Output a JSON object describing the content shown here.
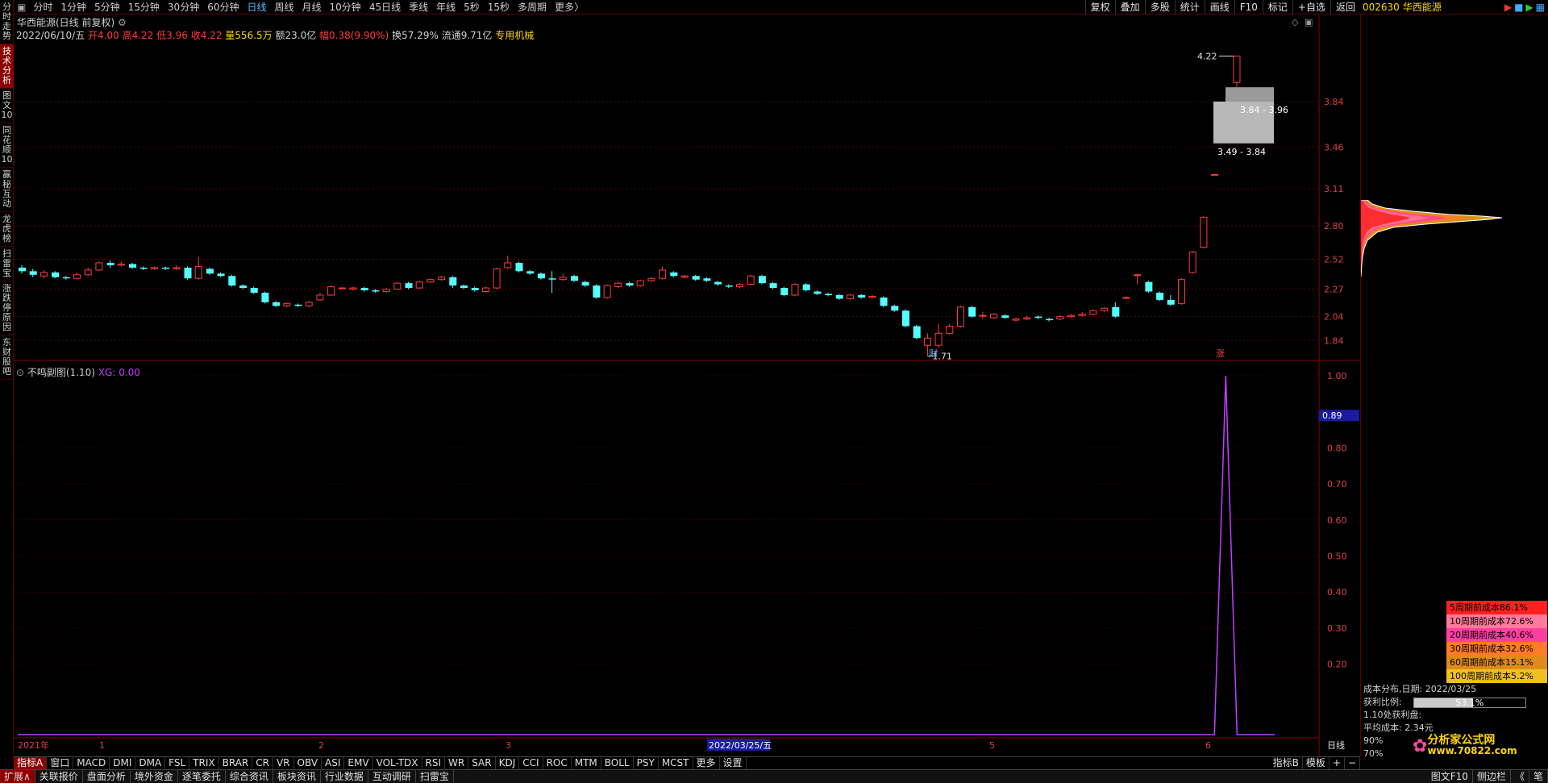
{
  "left_tabs": [
    "分时走势",
    "技术分析",
    "图文10",
    "同花顺10",
    "赢秘互动",
    "龙虎榜",
    "扫雷宝",
    "涨跌停原因",
    "东财股吧"
  ],
  "left_active": 1,
  "periods": [
    "分时",
    "1分钟",
    "5分钟",
    "15分钟",
    "30分钟",
    "60分钟",
    "日线",
    "周线",
    "月线",
    "10分钟",
    "45日线",
    "季线",
    "年线",
    "5秒",
    "15秒",
    "多周期",
    "更多〉"
  ],
  "period_active": 6,
  "tools": [
    "复权",
    "叠加",
    "多股",
    "统计",
    "画线",
    "F10",
    "标记",
    "+自选",
    "返回"
  ],
  "stock": {
    "code": "002630",
    "name": "华西能源"
  },
  "chart_title": "华西能源(日线 前复权)",
  "quote": {
    "date": "2022/06/10/五",
    "open": "开4.00",
    "high": "高4.22",
    "low": "低3.96",
    "close": "收4.22",
    "volume": "量556.5万",
    "amount": "额23.0亿",
    "change": "幅0.38(9.90%)",
    "turnover": "换57.29%",
    "float": "流通9.71亿",
    "sector": "专用机械"
  },
  "annotations": {
    "high_price": "4.22",
    "low_price": "1.71",
    "range1": "3.84 - 3.96",
    "range2": "3.49 - 3.84",
    "fin_mark": "财",
    "up_mark": "涨"
  },
  "main_axis": [
    "3.84",
    "3.46",
    "3.11",
    "2.80",
    "2.52",
    "2.27",
    "2.04",
    "1.84"
  ],
  "sub_indicator": {
    "name": "不鸣副图(1.10)",
    "xg_label": "XG: 0.00"
  },
  "sub_axis": [
    "1.00",
    "0.80",
    "0.70",
    "0.60",
    "0.50",
    "0.40",
    "0.30",
    "0.20"
  ],
  "sub_current": "0.89",
  "date_axis": [
    "2021年",
    "1",
    "2",
    "3",
    "2022/03/25/五",
    "5",
    "6"
  ],
  "period_label": "日线",
  "legend": [
    {
      "label": "5周期前成本86.1%",
      "color": "#ff2020"
    },
    {
      "label": "10周期前成本72.6%",
      "color": "#ff7a9a"
    },
    {
      "label": "20周期前成本40.6%",
      "color": "#ff3fa0"
    },
    {
      "label": "30周期前成本32.6%",
      "color": "#ff7a2a"
    },
    {
      "label": "60周期前成本15.1%",
      "color": "#e08a1a"
    },
    {
      "label": "100周期前成本5.2%",
      "color": "#f0c020"
    }
  ],
  "cost": {
    "title": "成本分布,日期:  2022/03/25",
    "profit_label": "获利比例:",
    "profit_value": "53.1%",
    "profit_at": "1.10处获利盘:",
    "avg_label": "平均成本:  2.34元",
    "p90": "90%",
    "p70": "70%"
  },
  "indicator_tabs": [
    "指标A",
    "窗口",
    "MACD",
    "DMI",
    "DMA",
    "FSL",
    "TRIX",
    "BRAR",
    "CR",
    "VR",
    "OBV",
    "ASI",
    "EMV",
    "VOL-TDX",
    "RSI",
    "WR",
    "SAR",
    "KDJ",
    "CCI",
    "ROC",
    "MTM",
    "BOLL",
    "PSY",
    "MCST",
    "更多",
    "设置"
  ],
  "indicator_right": [
    "指标B",
    "模板",
    "+",
    "−"
  ],
  "bottom_tabs": [
    "扩展∧",
    "关联报价",
    "盘面分析",
    "境外资金",
    "逐笔委托",
    "综合资讯",
    "板块资讯",
    "行业数据",
    "互动调研",
    "扫雷宝"
  ],
  "bottom_right": [
    "图文F10",
    "侧边栏",
    "《",
    "笔"
  ],
  "watermark": {
    "site": "分析家公式网",
    "url": "www.70822.com"
  },
  "colors": {
    "up": "#ff3b3b",
    "down": "#54ffff",
    "xg": "#c040ff",
    "grid": "#5a0000"
  },
  "chart_data": {
    "type": "candlestick",
    "title": "华西能源(日线 前复权)",
    "candles": [
      {
        "o": 2.45,
        "c": 2.42,
        "h": 2.47,
        "l": 2.4
      },
      {
        "o": 2.42,
        "c": 2.39,
        "h": 2.44,
        "l": 2.37
      },
      {
        "o": 2.38,
        "c": 2.41,
        "h": 2.43,
        "l": 2.36
      },
      {
        "o": 2.41,
        "c": 2.37,
        "h": 2.42,
        "l": 2.36
      },
      {
        "o": 2.37,
        "c": 2.36,
        "h": 2.38,
        "l": 2.35
      },
      {
        "o": 2.36,
        "c": 2.39,
        "h": 2.41,
        "l": 2.35
      },
      {
        "o": 2.39,
        "c": 2.43,
        "h": 2.45,
        "l": 2.38
      },
      {
        "o": 2.43,
        "c": 2.49,
        "h": 2.5,
        "l": 2.42
      },
      {
        "o": 2.49,
        "c": 2.47,
        "h": 2.51,
        "l": 2.45
      },
      {
        "o": 2.47,
        "c": 2.48,
        "h": 2.5,
        "l": 2.46
      },
      {
        "o": 2.48,
        "c": 2.45,
        "h": 2.49,
        "l": 2.44
      },
      {
        "o": 2.45,
        "c": 2.44,
        "h": 2.46,
        "l": 2.43
      },
      {
        "o": 2.44,
        "c": 2.45,
        "h": 2.46,
        "l": 2.43
      },
      {
        "o": 2.45,
        "c": 2.44,
        "h": 2.46,
        "l": 2.43
      },
      {
        "o": 2.44,
        "c": 2.45,
        "h": 2.47,
        "l": 2.43
      },
      {
        "o": 2.45,
        "c": 2.36,
        "h": 2.46,
        "l": 2.35
      },
      {
        "o": 2.36,
        "c": 2.46,
        "h": 2.54,
        "l": 2.35
      },
      {
        "o": 2.44,
        "c": 2.4,
        "h": 2.45,
        "l": 2.39
      },
      {
        "o": 2.4,
        "c": 2.38,
        "h": 2.41,
        "l": 2.37
      },
      {
        "o": 2.38,
        "c": 2.3,
        "h": 2.39,
        "l": 2.29
      },
      {
        "o": 2.3,
        "c": 2.28,
        "h": 2.31,
        "l": 2.27
      },
      {
        "o": 2.28,
        "c": 2.24,
        "h": 2.29,
        "l": 2.23
      },
      {
        "o": 2.24,
        "c": 2.16,
        "h": 2.25,
        "l": 2.15
      },
      {
        "o": 2.16,
        "c": 2.13,
        "h": 2.17,
        "l": 2.12
      },
      {
        "o": 2.13,
        "c": 2.15,
        "h": 2.16,
        "l": 2.12
      },
      {
        "o": 2.14,
        "c": 2.13,
        "h": 2.15,
        "l": 2.12
      },
      {
        "o": 2.13,
        "c": 2.16,
        "h": 2.17,
        "l": 2.12
      },
      {
        "o": 2.18,
        "c": 2.22,
        "h": 2.24,
        "l": 2.17
      },
      {
        "o": 2.22,
        "c": 2.29,
        "h": 2.3,
        "l": 2.21
      },
      {
        "o": 2.28,
        "c": 2.28,
        "h": 2.29,
        "l": 2.27
      },
      {
        "o": 2.27,
        "c": 2.28,
        "h": 2.29,
        "l": 2.26
      },
      {
        "o": 2.28,
        "c": 2.26,
        "h": 2.29,
        "l": 2.25
      },
      {
        "o": 2.26,
        "c": 2.25,
        "h": 2.27,
        "l": 2.24
      },
      {
        "o": 2.25,
        "c": 2.27,
        "h": 2.28,
        "l": 2.24
      },
      {
        "o": 2.27,
        "c": 2.32,
        "h": 2.33,
        "l": 2.26
      },
      {
        "o": 2.32,
        "c": 2.28,
        "h": 2.33,
        "l": 2.27
      },
      {
        "o": 2.28,
        "c": 2.33,
        "h": 2.34,
        "l": 2.27
      },
      {
        "o": 2.33,
        "c": 2.35,
        "h": 2.36,
        "l": 2.32
      },
      {
        "o": 2.35,
        "c": 2.37,
        "h": 2.38,
        "l": 2.34
      },
      {
        "o": 2.37,
        "c": 2.3,
        "h": 2.38,
        "l": 2.28
      },
      {
        "o": 2.3,
        "c": 2.28,
        "h": 2.31,
        "l": 2.27
      },
      {
        "o": 2.28,
        "c": 2.26,
        "h": 2.29,
        "l": 2.25
      },
      {
        "o": 2.25,
        "c": 2.28,
        "h": 2.29,
        "l": 2.24
      },
      {
        "o": 2.28,
        "c": 2.44,
        "h": 2.45,
        "l": 2.27
      },
      {
        "o": 2.45,
        "c": 2.49,
        "h": 2.55,
        "l": 2.44
      },
      {
        "o": 2.49,
        "c": 2.42,
        "h": 2.5,
        "l": 2.41
      },
      {
        "o": 2.42,
        "c": 2.4,
        "h": 2.43,
        "l": 2.39
      },
      {
        "o": 2.4,
        "c": 2.36,
        "h": 2.41,
        "l": 2.35
      },
      {
        "o": 2.36,
        "c": 2.35,
        "h": 2.42,
        "l": 2.24
      },
      {
        "o": 2.35,
        "c": 2.37,
        "h": 2.4,
        "l": 2.34
      },
      {
        "o": 2.38,
        "c": 2.34,
        "h": 2.39,
        "l": 2.33
      },
      {
        "o": 2.33,
        "c": 2.3,
        "h": 2.34,
        "l": 2.29
      },
      {
        "o": 2.3,
        "c": 2.2,
        "h": 2.31,
        "l": 2.19
      },
      {
        "o": 2.2,
        "c": 2.3,
        "h": 2.31,
        "l": 2.19
      },
      {
        "o": 2.29,
        "c": 2.32,
        "h": 2.33,
        "l": 2.28
      },
      {
        "o": 2.32,
        "c": 2.3,
        "h": 2.33,
        "l": 2.29
      },
      {
        "o": 2.3,
        "c": 2.34,
        "h": 2.35,
        "l": 2.29
      },
      {
        "o": 2.34,
        "c": 2.36,
        "h": 2.37,
        "l": 2.33
      },
      {
        "o": 2.36,
        "c": 2.43,
        "h": 2.46,
        "l": 2.35
      },
      {
        "o": 2.41,
        "c": 2.38,
        "h": 2.42,
        "l": 2.37
      },
      {
        "o": 2.37,
        "c": 2.38,
        "h": 2.39,
        "l": 2.36
      },
      {
        "o": 2.38,
        "c": 2.35,
        "h": 2.39,
        "l": 2.34
      },
      {
        "o": 2.36,
        "c": 2.34,
        "h": 2.37,
        "l": 2.33
      },
      {
        "o": 2.33,
        "c": 2.31,
        "h": 2.34,
        "l": 2.3
      },
      {
        "o": 2.3,
        "c": 2.29,
        "h": 2.31,
        "l": 2.28
      },
      {
        "o": 2.29,
        "c": 2.31,
        "h": 2.32,
        "l": 2.28
      },
      {
        "o": 2.31,
        "c": 2.38,
        "h": 2.39,
        "l": 2.3
      },
      {
        "o": 2.38,
        "c": 2.32,
        "h": 2.39,
        "l": 2.31
      },
      {
        "o": 2.32,
        "c": 2.28,
        "h": 2.33,
        "l": 2.27
      },
      {
        "o": 2.28,
        "c": 2.22,
        "h": 2.29,
        "l": 2.21
      },
      {
        "o": 2.22,
        "c": 2.31,
        "h": 2.32,
        "l": 2.21
      },
      {
        "o": 2.31,
        "c": 2.26,
        "h": 2.32,
        "l": 2.25
      },
      {
        "o": 2.25,
        "c": 2.23,
        "h": 2.26,
        "l": 2.22
      },
      {
        "o": 2.23,
        "c": 2.22,
        "h": 2.24,
        "l": 2.21
      },
      {
        "o": 2.22,
        "c": 2.19,
        "h": 2.23,
        "l": 2.18
      },
      {
        "o": 2.19,
        "c": 2.22,
        "h": 2.23,
        "l": 2.18
      },
      {
        "o": 2.22,
        "c": 2.2,
        "h": 2.23,
        "l": 2.19
      },
      {
        "o": 2.2,
        "c": 2.21,
        "h": 2.22,
        "l": 2.19
      },
      {
        "o": 2.2,
        "c": 2.13,
        "h": 2.21,
        "l": 2.12
      },
      {
        "o": 2.13,
        "c": 2.09,
        "h": 2.14,
        "l": 2.08
      },
      {
        "o": 2.09,
        "c": 1.96,
        "h": 2.1,
        "l": 1.95
      },
      {
        "o": 1.96,
        "c": 1.86,
        "h": 1.97,
        "l": 1.85
      },
      {
        "o": 1.8,
        "c": 1.86,
        "h": 1.9,
        "l": 1.71
      },
      {
        "o": 1.8,
        "c": 1.9,
        "h": 1.98,
        "l": 1.78
      },
      {
        "o": 1.9,
        "c": 1.96,
        "h": 1.98,
        "l": 1.89
      },
      {
        "o": 1.96,
        "c": 2.12,
        "h": 2.13,
        "l": 1.95
      },
      {
        "o": 2.12,
        "c": 2.04,
        "h": 2.13,
        "l": 2.03
      },
      {
        "o": 2.05,
        "c": 2.05,
        "h": 2.08,
        "l": 2.02
      },
      {
        "o": 2.03,
        "c": 2.06,
        "h": 2.07,
        "l": 2.02
      },
      {
        "o": 2.05,
        "c": 2.03,
        "h": 2.06,
        "l": 2.02
      },
      {
        "o": 2.01,
        "c": 2.02,
        "h": 2.03,
        "l": 2.0
      },
      {
        "o": 2.02,
        "c": 2.03,
        "h": 2.05,
        "l": 2.01
      },
      {
        "o": 2.04,
        "c": 2.03,
        "h": 2.05,
        "l": 2.02
      },
      {
        "o": 2.02,
        "c": 2.01,
        "h": 2.03,
        "l": 2.0
      },
      {
        "o": 2.02,
        "c": 2.04,
        "h": 2.05,
        "l": 2.01
      },
      {
        "o": 2.04,
        "c": 2.05,
        "h": 2.06,
        "l": 2.03
      },
      {
        "o": 2.05,
        "c": 2.06,
        "h": 2.08,
        "l": 2.04
      },
      {
        "o": 2.06,
        "c": 2.09,
        "h": 2.1,
        "l": 2.05
      },
      {
        "o": 2.09,
        "c": 2.11,
        "h": 2.12,
        "l": 2.08
      },
      {
        "o": 2.12,
        "c": 2.04,
        "h": 2.16,
        "l": 2.03
      },
      {
        "o": 2.2,
        "c": 2.2,
        "h": 2.21,
        "l": 2.19
      },
      {
        "o": 2.39,
        "c": 2.39,
        "h": 2.4,
        "l": 2.31
      },
      {
        "o": 2.33,
        "c": 2.25,
        "h": 2.34,
        "l": 2.24
      },
      {
        "o": 2.24,
        "c": 2.18,
        "h": 2.25,
        "l": 2.17
      },
      {
        "o": 2.18,
        "c": 2.14,
        "h": 2.22,
        "l": 2.13
      },
      {
        "o": 2.15,
        "c": 2.35,
        "h": 2.36,
        "l": 2.14
      },
      {
        "o": 2.41,
        "c": 2.58,
        "h": 2.59,
        "l": 2.4
      },
      {
        "o": 2.62,
        "c": 2.87,
        "h": 2.88,
        "l": 2.61
      },
      {
        "o": 3.23,
        "c": 3.23,
        "h": 3.23,
        "l": 3.23
      },
      {
        "o": 3.53,
        "c": 3.53,
        "h": 3.53,
        "l": 3.53
      },
      {
        "o": 4.0,
        "c": 4.22,
        "h": 4.22,
        "l": 3.96
      }
    ],
    "ylim": [
      1.7,
      4.4
    ],
    "xg_series": {
      "index": 109,
      "value": 1.0
    }
  }
}
